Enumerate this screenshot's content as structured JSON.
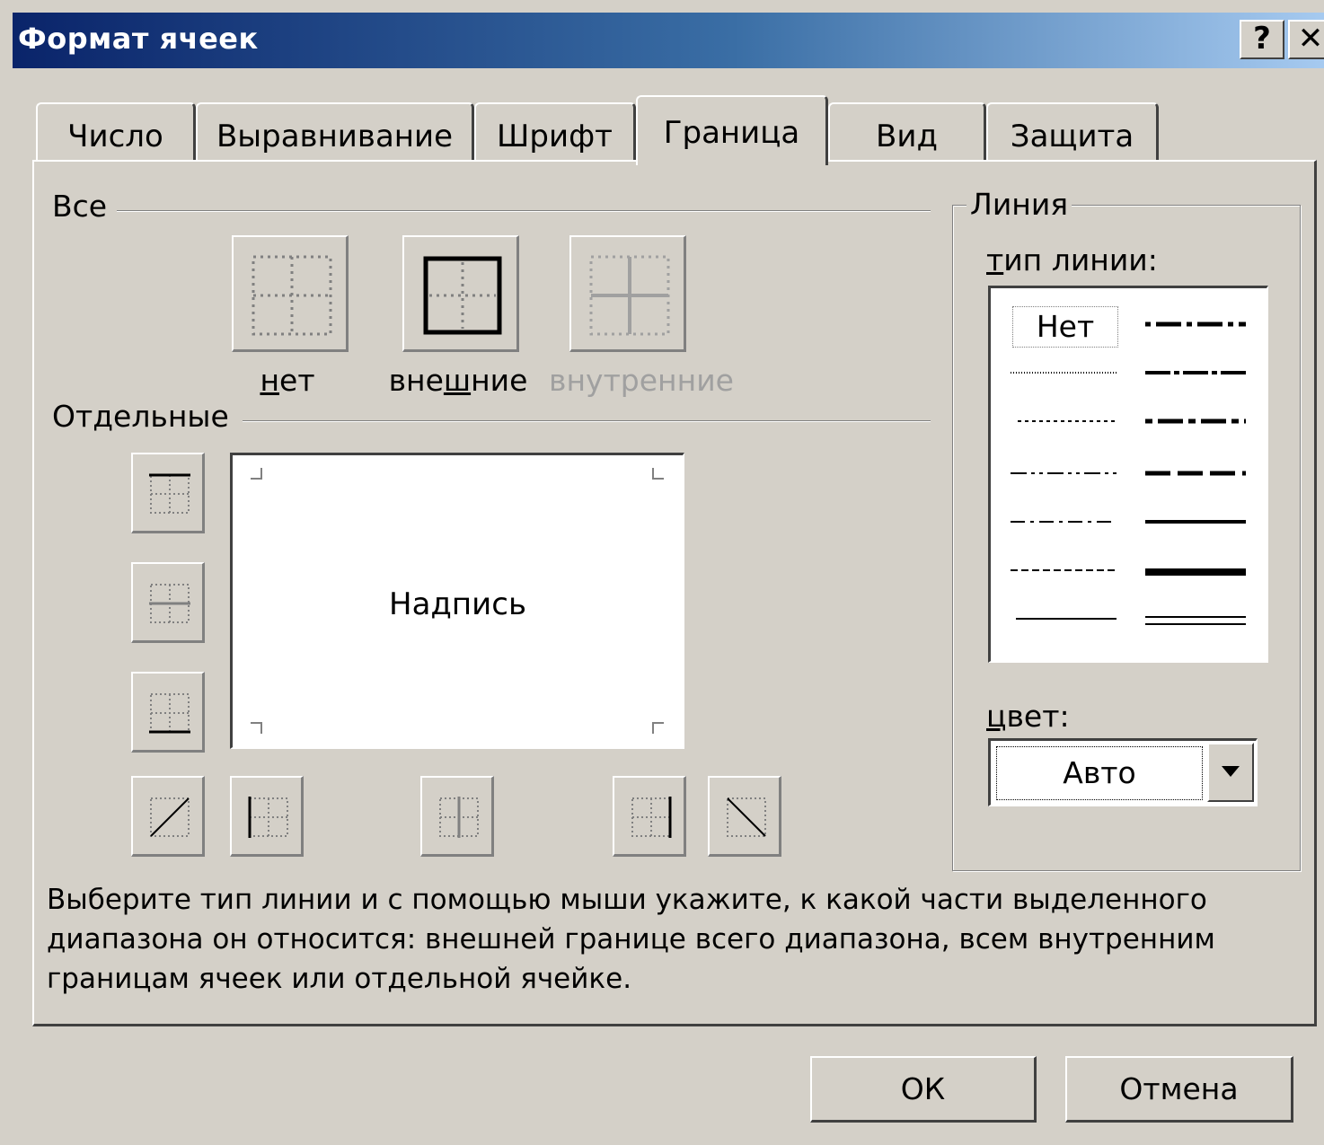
{
  "window": {
    "title": "Формат ячеек",
    "help_label": "?",
    "close_label": "✕"
  },
  "tabs": [
    {
      "label": "Число"
    },
    {
      "label": "Выравнивание"
    },
    {
      "label": "Шрифт"
    },
    {
      "label": "Граница",
      "active": true
    },
    {
      "label": "Вид"
    },
    {
      "label": "Защита"
    }
  ],
  "all_section": {
    "label": "Все",
    "presets": {
      "none": {
        "label": "нет",
        "mnemonic": "н",
        "rest": "ет"
      },
      "outline": {
        "label": "внешние",
        "prefix": "вне",
        "mnemonic": "ш",
        "rest": "ние"
      },
      "inside": {
        "label": "внутренние",
        "enabled": false
      }
    }
  },
  "individual_section": {
    "label": "Отдельные"
  },
  "preview": {
    "text": "Надпись"
  },
  "line_group": {
    "title": "Линия",
    "style_label_mnemonic": "т",
    "style_label_rest": "ип линии:",
    "none_label": "Нет",
    "color_label_mnemonic": "ц",
    "color_label_rest": "вет:",
    "color_value": "Авто"
  },
  "hint": "Выберите тип линии и с помощью мыши укажите, к какой части выделенного диапазона он относится: внешней границе всего диапазона, всем внутренним границам ячеек или отдельной ячейке.",
  "buttons": {
    "ok": "ОК",
    "cancel": "Отмена"
  }
}
